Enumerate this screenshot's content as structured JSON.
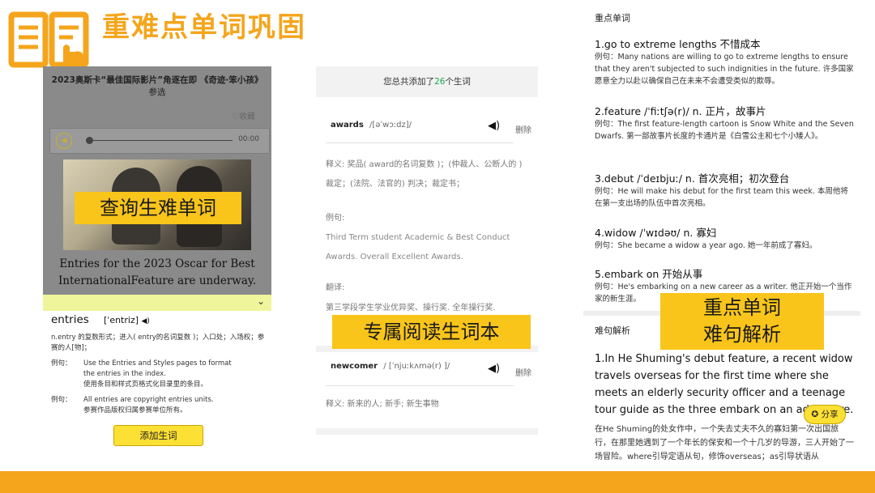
{
  "header": {
    "title": "重难点单词巩固",
    "icon": "book-hand-icon"
  },
  "colors": {
    "accent": "#f4a51c",
    "label_bg": "#f9c51a",
    "button": "#fde034",
    "count_green": "#1aa84b"
  },
  "panel1": {
    "headline_line1": "2023奥斯卡“最佳国际影片”角逐在即 《奇迹·笨小孩》",
    "headline_line2": "参选",
    "favorite": "♡收藏",
    "time": "00:00",
    "english_text": "Entries for the 2023 Oscar for Best InternationalFeature are underway.",
    "overlay_label": "查询生难单词"
  },
  "entries": {
    "word": "entries",
    "phonetic": "[ˈentriz]",
    "definition": "n.entry 的复数形式；进入( entry的名词复数 )；入口处；入场权；参赛的人[物]；",
    "examples": [
      {
        "label": "例句：",
        "en": "Use the Entries and Styles pages to format the entries in the index.",
        "zh": "使用条目和样式页格式化目录里的条目。"
      },
      {
        "label": "例句：",
        "en": "All entries are copyright entries units.",
        "zh": "参赛作品版权归属参赛单位所有。"
      }
    ],
    "add_button": "添加生词"
  },
  "panel2": {
    "count_prefix": "您总共添加了",
    "count": "26",
    "count_suffix": "个生词",
    "delete_label": "删除",
    "word1": {
      "word": "awards",
      "phonetic": "/[əˈwɔːdz]/",
      "gloss": "释义: 奖品( award的名词复数 )；(仲裁人、公断人的 ) 裁定；(法院、法官的) 判决；裁定书；",
      "example_label": "例句:",
      "example": "Third Term student Academic & Best Conduct Awards. Overall Excellent Awards.",
      "translation_label": "翻译:",
      "translation": "第三学段学生学业优异奖、操行奖. 全年操行奖."
    },
    "word2": {
      "word": "newcomer",
      "phonetic": "/ [ˈnjuːkʌmə(r) ]/",
      "gloss": "释义: 新来的人; 新手; 新生事物"
    },
    "overlay_label": "专属阅读生词本"
  },
  "panel3": {
    "key_words_title": "重点单词",
    "items": [
      {
        "head": "1.go to extreme lengths 不惜成本",
        "example": "例句：Many nations are willing to go to extreme lengths to ensure that they aren't subjected to such indignities in the future. 许多国家愿意全力以赴以确保自己在未来不会遭受类似的欺辱。"
      },
      {
        "head": "2.feature /ˈfiːtʃə(r)/ n. 正片，故事片",
        "example": "例句：The first feature-length cartoon is Snow White and the Seven Dwarfs. 第一部故事片长度的卡通片是《白雪公主和七个小矮人》。"
      },
      {
        "head": "3.debut /ˈdeɪbjuː/ n. 首次亮相；初次登台",
        "example": "例句：He will make his debut for the first team this week. 本周他将在第一支出场的队伍中首次亮相。"
      },
      {
        "head": "4.widow /ˈwɪdəʊ/ n. 寡妇",
        "example": "例句：She became a widow a year ago. 她一年前成了寡妇。"
      },
      {
        "head": "5.embark on 开始从事",
        "example": "例句：He's embarking on a new career as a writer. 他正开始一个当作家的新生涯。"
      }
    ],
    "hard_sentence_title": "难句解析",
    "sentence_en": "1.In He Shuming's debut feature, a recent widow travels overseas for the first time where she meets an elderly security officer and a teenage tour guide as the three embark on an adventure.",
    "sentence_zh": "在He Shuming的处女作中，一个失去丈夫不久的寡妇第一次出国旅行，在那里她遇到了一个年长的保安和一个十几岁的导游，三人开始了一场冒险。where引导定语从句，修饰overseas；as引导状语从",
    "share": "分享",
    "overlay_label_line1": "重点单词",
    "overlay_label_line2": "难句解析"
  }
}
